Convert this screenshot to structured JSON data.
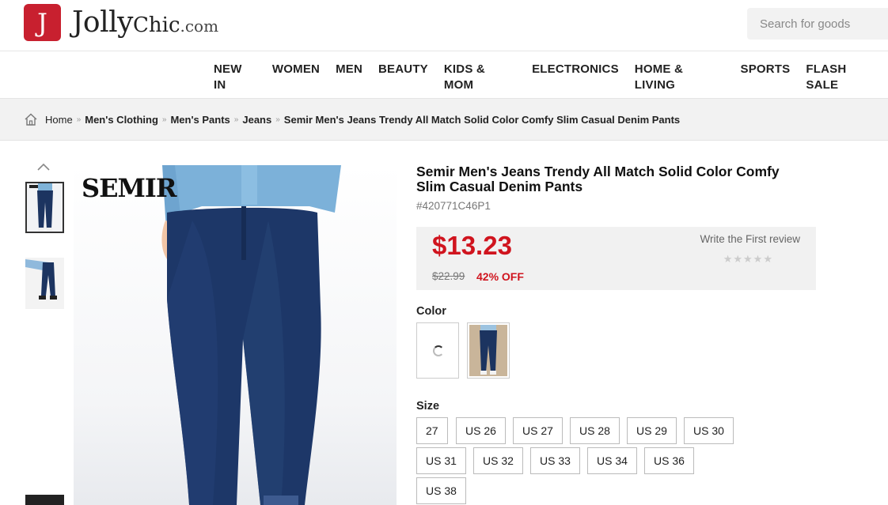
{
  "header": {
    "logo_letter": "J",
    "logo_jolly": "Jolly",
    "logo_chic": "Chic",
    "logo_com": ".com",
    "search_placeholder": "Search for goods",
    "brand_color": "#c8202f"
  },
  "nav": {
    "items": [
      "NEW IN",
      "WOMEN",
      "MEN",
      "BEAUTY",
      "KIDS & MOM",
      "ELECTRONICS",
      "HOME & LIVING",
      "SPORTS",
      "FLASH SALE"
    ]
  },
  "breadcrumb": {
    "icon": "home-icon",
    "items": [
      "Home",
      "Men's Clothing",
      "Men's Pants",
      "Jeans",
      "Semir Men's Jeans Trendy All Match Solid Color Comfy Slim Casual Denim Pants"
    ],
    "separator": "»"
  },
  "gallery": {
    "brand_mark": "SEMIR",
    "nav_icon": "chevron-up-icon"
  },
  "product": {
    "title": "Semir Men's Jeans Trendy All Match Solid Color Comfy Slim Casual Denim Pants",
    "sku": "#420771C46P1",
    "price": "$13.23",
    "old_price": "$22.99",
    "discount": "42% OFF",
    "review_text": "Write the First review",
    "stars": "★★★★★",
    "price_color": "#d0141e",
    "color_label": "Color",
    "size_label": "Size",
    "sizes": [
      "27",
      "US 26",
      "US 27",
      "US 28",
      "US 29",
      "US 30",
      "US 31",
      "US 32",
      "US 33",
      "US 34",
      "US 36",
      "US 38"
    ]
  }
}
